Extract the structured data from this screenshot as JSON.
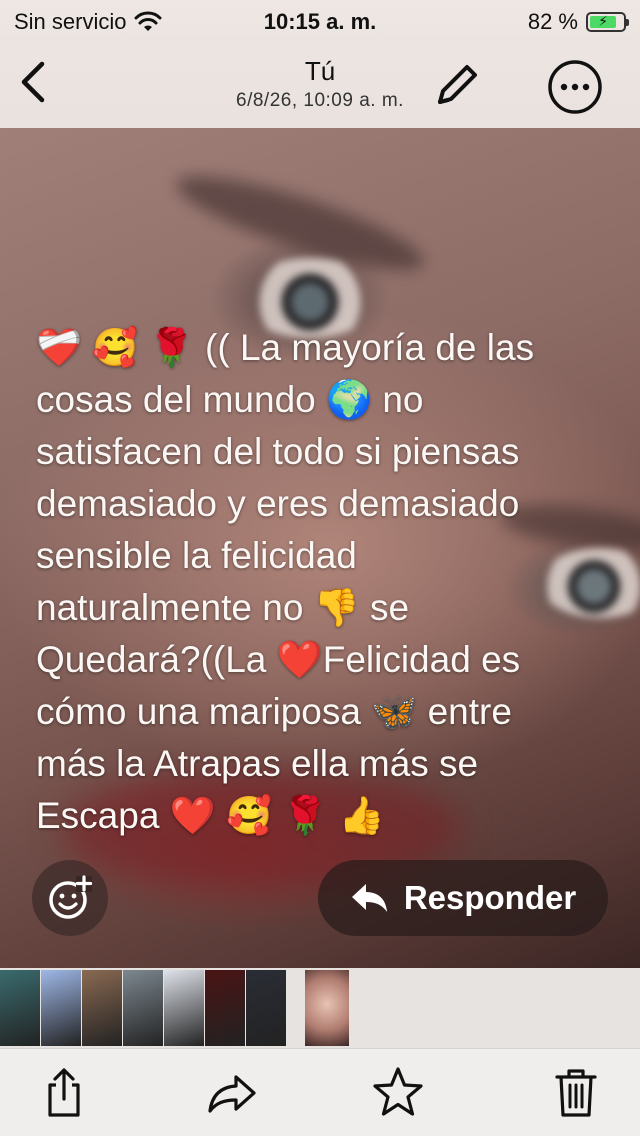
{
  "status_bar": {
    "carrier": "Sin servicio",
    "time": "10:15 a. m.",
    "battery_percent": "82 %",
    "battery_level": 0.82
  },
  "nav": {
    "title": "Tú",
    "subtitle": "6/8/26, 10:09 a. m."
  },
  "photo": {
    "overlay_text": "❤️‍🩹 🥰 🌹 (( La mayoría de las\ncosas del mundo 🌍 no\nsatisfacen del todo si piensas\ndemasiado y eres demasiado\nsensible la felicidad\nnaturalmente no 👎 se\nQuedará?((La ❤️Felicidad es\ncómo una mariposa 🦋 entre\nmás la Atrapas ella más se\nEscapa ❤️ 🥰 🌹 👍"
  },
  "actions": {
    "reply_label": "Responder"
  },
  "thumbnails": [
    {
      "icon": "thumbnail-car",
      "color": "#3a6b6e"
    },
    {
      "icon": "thumbnail-screenshot-chat",
      "color": "#9fb8e8"
    },
    {
      "icon": "thumbnail-back-tattoo",
      "color": "#8a6a52"
    },
    {
      "icon": "thumbnail-room",
      "color": "#7d8890"
    },
    {
      "icon": "thumbnail-screenshot-text",
      "color": "#dfe3ea"
    },
    {
      "icon": "thumbnail-roses",
      "color": "#4a1414"
    },
    {
      "icon": "thumbnail-statue",
      "color": "#2a2d36"
    },
    {
      "icon": "thumbnail-face-selected",
      "color": "#b07c70"
    }
  ],
  "toolbar": {
    "icons": [
      "share-icon",
      "forward-icon",
      "favorite-star-icon",
      "trash-icon"
    ]
  },
  "colors": {
    "reply_bg": "#281c1a",
    "status_bg": "#efe7e3",
    "toolbar_bg": "#f0eeec"
  }
}
